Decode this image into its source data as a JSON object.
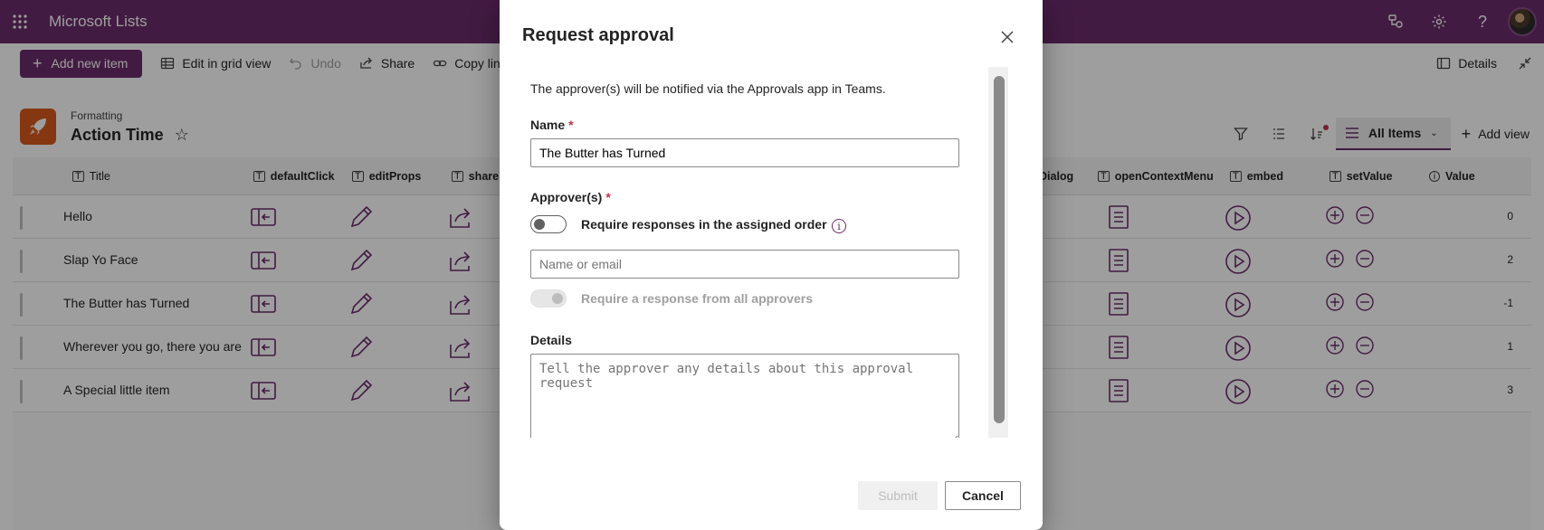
{
  "app": {
    "name": "Microsoft Lists"
  },
  "commandbar": {
    "add_new_item": "Add new item",
    "edit_grid": "Edit in grid view",
    "undo": "Undo",
    "share": "Share",
    "copy_link": "Copy lin",
    "details": "Details"
  },
  "list": {
    "subtitle": "Formatting",
    "title": "Action Time",
    "view": "All Items",
    "add_view": "Add view"
  },
  "columns": {
    "title": "Title",
    "defaultClick": "defaultClick",
    "editProps": "editProps",
    "share": "share",
    "dialog": "Dialog",
    "openContextMenu": "openContextMenu",
    "embed": "embed",
    "setValue": "setValue",
    "value": "Value"
  },
  "rows": [
    {
      "title": "Hello",
      "value": "0"
    },
    {
      "title": "Slap Yo Face",
      "value": "2"
    },
    {
      "title": "The Butter has Turned",
      "value": "-1"
    },
    {
      "title": "Wherever you go, there you are",
      "value": "1"
    },
    {
      "title": "A Special little item",
      "value": "3"
    }
  ],
  "dialog": {
    "title": "Request approval",
    "notice": "The approver(s) will be notified via the Approvals app in Teams.",
    "name_label": "Name",
    "required_mark": "*",
    "name_value": "The Butter has Turned",
    "approvers_label": "Approver(s)",
    "ordered_toggle_label": "Require responses in the assigned order",
    "ordered_toggle_on": false,
    "approver_placeholder": "Name or email",
    "all_toggle_label": "Require a response from all approvers",
    "details_label": "Details",
    "details_placeholder": "Tell the approver any details about this approval request",
    "submit": "Submit",
    "cancel": "Cancel"
  },
  "colors": {
    "brand": "#6b2d6b",
    "list_icon": "#d75a1e",
    "required": "#c4314b"
  }
}
